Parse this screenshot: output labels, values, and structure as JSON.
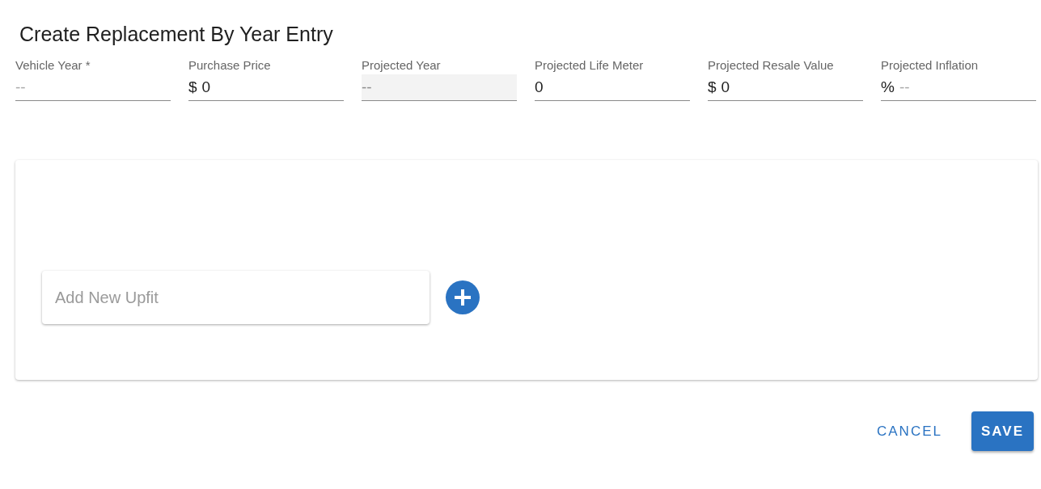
{
  "title": "Create Replacement By Year Entry",
  "fields": [
    {
      "label": "Vehicle Year *",
      "placeholder": "--",
      "disabled": false
    },
    {
      "label": "Purchase Price",
      "prefix": "$",
      "value": "0",
      "disabled": false
    },
    {
      "label": "Projected Year",
      "placeholder": "--",
      "disabled": true
    },
    {
      "label": "Projected Life Meter",
      "value": "0",
      "disabled": false
    },
    {
      "label": "Projected Resale Value",
      "prefix": "$",
      "value": "0",
      "disabled": false
    },
    {
      "label": "Projected Inflation",
      "prefix": "%",
      "placeholder": "--",
      "disabled": false
    }
  ],
  "upfit": {
    "placeholder": "Add New Upfit"
  },
  "buttons": [
    {
      "label": "CANCEL",
      "kind": "text"
    },
    {
      "label": "SAVE",
      "kind": "primary"
    }
  ]
}
